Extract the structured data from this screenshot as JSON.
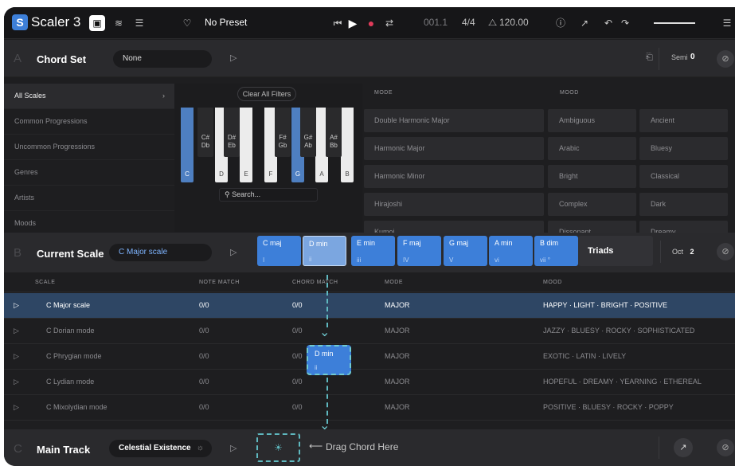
{
  "topbar": {
    "app_name": "Scaler 3",
    "logo_letter": "S",
    "preset": "No Preset",
    "position": "001.1",
    "time_sig": "4/4",
    "tempo": "120.00"
  },
  "chord_set": {
    "letter": "A",
    "title": "Chord Set",
    "selector": "None",
    "semi_label": "Semi",
    "semi_value": "0"
  },
  "browser": {
    "sidebar": [
      {
        "label": "All Scales"
      },
      {
        "label": "Common Progressions"
      },
      {
        "label": "Uncommon Progressions"
      },
      {
        "label": "Genres"
      },
      {
        "label": "Artists"
      },
      {
        "label": "Moods"
      }
    ],
    "clear_filters": "Clear All Filters",
    "search_placeholder": "Search...",
    "white_keys": [
      "C",
      "D",
      "E",
      "F",
      "G",
      "A",
      "B"
    ],
    "black_keys": [
      {
        "top": "C#",
        "bottom": "Db"
      },
      {
        "top": "D#",
        "bottom": "Eb"
      },
      {
        "top": "F#",
        "bottom": "Gb"
      },
      {
        "top": "G#",
        "bottom": "Ab"
      },
      {
        "top": "A#",
        "bottom": "Bb"
      }
    ],
    "mode_header": "MODE",
    "mood_header": "MOOD",
    "modes": [
      "Double Harmonic Major",
      "Harmonic Major",
      "Harmonic Minor",
      "Hirajoshi",
      "Kumoi"
    ],
    "moods_col1": [
      "Ambiguous",
      "Arabic",
      "Bright",
      "Complex",
      "Dissonant"
    ],
    "moods_col2": [
      "Ancient",
      "Bluesy",
      "Classical",
      "Dark",
      "Dreamy"
    ]
  },
  "current_scale": {
    "letter": "B",
    "title": "Current Scale",
    "selector": "C Major scale",
    "chords": [
      {
        "name": "C maj",
        "degree": "I"
      },
      {
        "name": "D min",
        "degree": "ii"
      },
      {
        "name": "E min",
        "degree": "iii"
      },
      {
        "name": "F maj",
        "degree": "IV"
      },
      {
        "name": "G maj",
        "degree": "V"
      },
      {
        "name": "A min",
        "degree": "vi"
      },
      {
        "name": "B dim",
        "degree": "vii °"
      }
    ],
    "triads": "Triads",
    "oct_label": "Oct",
    "oct_value": "2"
  },
  "scale_table": {
    "headers": {
      "scale": "SCALE",
      "note_match": "NOTE MATCH",
      "chord_match": "CHORD MATCH",
      "mode": "MODE",
      "mood": "MOOD"
    },
    "rows": [
      {
        "scale": "C Major scale",
        "note": "0/0",
        "chord": "0/0",
        "mode": "MAJOR",
        "mood": "HAPPY · LIGHT · BRIGHT · POSITIVE"
      },
      {
        "scale": "C Dorian mode",
        "note": "0/0",
        "chord": "0/0",
        "mode": "MAJOR",
        "mood": "JAZZY · BLUESY · ROCKY · SOPHISTICATED"
      },
      {
        "scale": "C Phrygian mode",
        "note": "0/0",
        "chord": "0/0",
        "mode": "MAJOR",
        "mood": "EXOTIC · LATIN · LIVELY"
      },
      {
        "scale": "C Lydian mode",
        "note": "0/0",
        "chord": "0/0",
        "mode": "MAJOR",
        "mood": "HOPEFUL · DREAMY · YEARNING · ETHEREAL"
      },
      {
        "scale": "C Mixolydian mode",
        "note": "0/0",
        "chord": "0/0",
        "mode": "MAJOR",
        "mood": "POSITIVE · BLUESY · ROCKY · POPPY"
      }
    ]
  },
  "drag_chord": {
    "name": "D min",
    "degree": "ii"
  },
  "main_track": {
    "letter": "C",
    "title": "Main Track",
    "selector": "Celestial Existence",
    "drag_hint": "Drag Chord Here"
  },
  "colors": {
    "accent": "#3d7fd9",
    "drag": "#5fb8bf",
    "selected_row": "#2e4664"
  }
}
